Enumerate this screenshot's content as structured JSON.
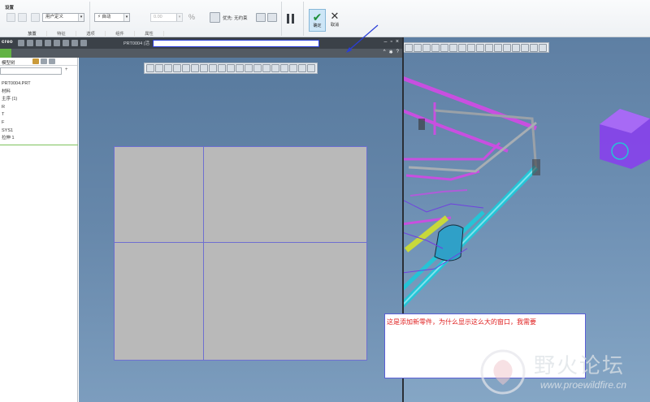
{
  "ribbon": {
    "group_title": "设置",
    "reference_mode": "用户定义",
    "auto_mode": "自动",
    "value_field": "0.00",
    "constraint_label": "优先: 无约束",
    "tabs": [
      "放置",
      "特征",
      "选项",
      "组件",
      "属性"
    ],
    "ok_label": "确定",
    "cancel_label": "取消"
  },
  "child_window": {
    "app_logo": "creo",
    "title": "PRT0004 (活",
    "title_field": "",
    "window_buttons": [
      "–",
      "▫",
      "×"
    ],
    "help_icons": [
      "^",
      "✱",
      "?"
    ]
  },
  "model_tree": {
    "header_label": "模型树",
    "filter_icon": "+",
    "items": [
      "PRT0004.PRT",
      "材料",
      "主序 (1)",
      "R",
      "T",
      "F",
      "SYS1",
      "拉伸 1"
    ]
  },
  "annotation": {
    "text": "这是添加新零件，为什么显示这么大的窗口，我需要"
  },
  "watermark": {
    "brand_cn": "野火论坛",
    "url": "www.proewildfire.cn"
  },
  "colors": {
    "accent_blue": "#2a3ed8",
    "annotation_red": "#e02020",
    "model_cyan": "#25c4d6",
    "model_magenta": "#c84fe0",
    "model_purple": "#8a3cf0",
    "model_yellow": "#c8d93a"
  }
}
